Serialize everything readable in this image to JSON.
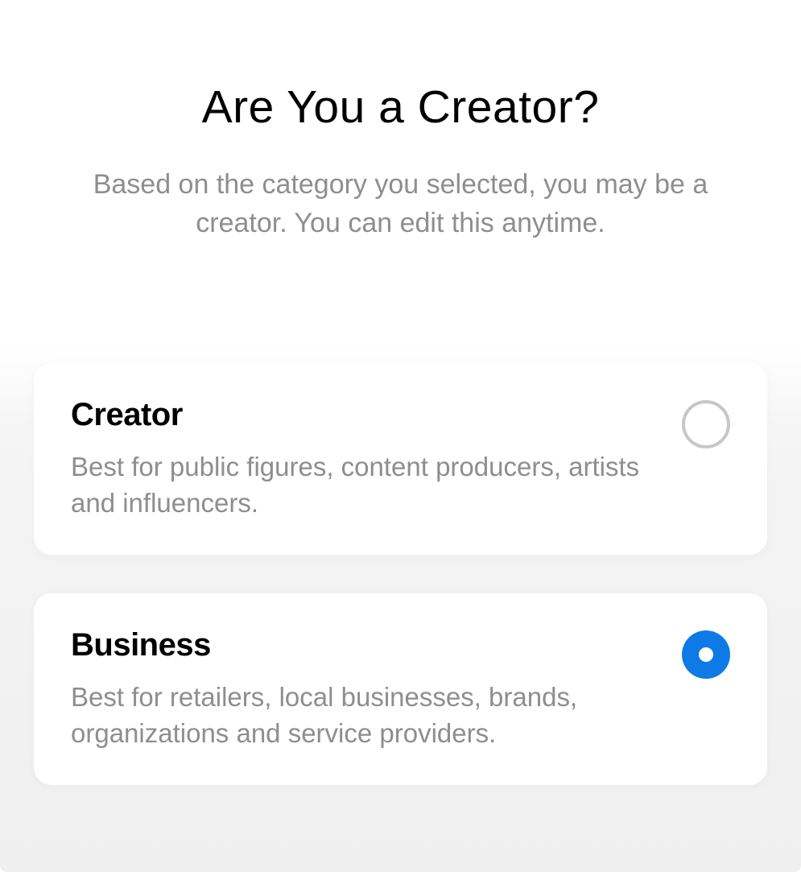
{
  "header": {
    "title": "Are You a Creator?",
    "subtitle": "Based on the category you selected, you may be a creator. You can edit this anytime."
  },
  "options": [
    {
      "title": "Creator",
      "description": "Best for public figures, content producers, artists and influencers.",
      "selected": false
    },
    {
      "title": "Business",
      "description": "Best for retailers, local businesses, brands, organizations and service providers.",
      "selected": true
    }
  ],
  "colors": {
    "accent": "#0d7ae6",
    "textPrimary": "#000000",
    "textSecondary": "#8e8e8e",
    "radioBorder": "#c7c7c7"
  }
}
